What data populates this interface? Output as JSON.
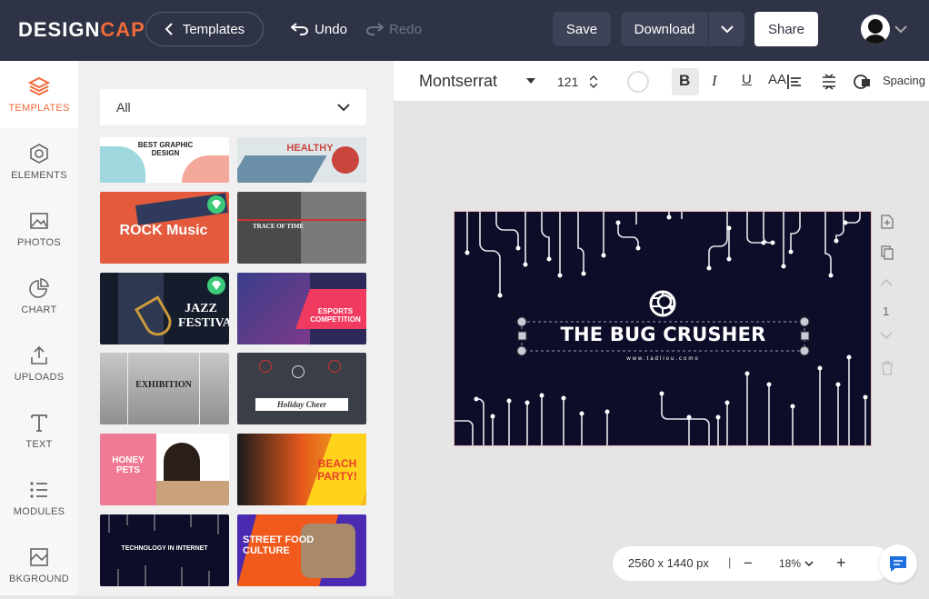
{
  "header": {
    "logo_main": "DESIGN",
    "logo_accent": "CAP",
    "templates_label": "Templates",
    "undo_label": "Undo",
    "redo_label": "Redo",
    "save_label": "Save",
    "download_label": "Download",
    "share_label": "Share"
  },
  "sidebar": {
    "items": [
      {
        "label": "TEMPLATES",
        "icon": "layers-icon"
      },
      {
        "label": "ELEMENTS",
        "icon": "shapes-icon"
      },
      {
        "label": "PHOTOS",
        "icon": "image-icon"
      },
      {
        "label": "CHART",
        "icon": "pie-chart-icon"
      },
      {
        "label": "UPLOADS",
        "icon": "upload-icon"
      },
      {
        "label": "TEXT",
        "icon": "text-icon"
      },
      {
        "label": "MODULES",
        "icon": "list-icon"
      },
      {
        "label": "BKGROUND",
        "icon": "background-icon"
      }
    ]
  },
  "panel": {
    "filter_value": "All",
    "thumbs": [
      {
        "title": "BEST GRAPHIC DESIGN"
      },
      {
        "title": "HEALTHY"
      },
      {
        "title": "ROCK Music"
      },
      {
        "title": "TRACE OF TIME"
      },
      {
        "title": "JAZZ FESTIVAL"
      },
      {
        "title": "ESPORTS COMPETITION"
      },
      {
        "title": "EXHIBITION"
      },
      {
        "title": "Holiday Cheer"
      },
      {
        "title": "HONEY PETS"
      },
      {
        "title": "BEACH PARTY!"
      },
      {
        "title": "TECHNOLOGY IN INTERNET"
      },
      {
        "title": "STREET FOOD CULTURE"
      }
    ]
  },
  "toolbar": {
    "font": "Montserrat",
    "size": "121",
    "bold": "B",
    "italic": "I",
    "underline": "U",
    "case": "AA",
    "spacing": "Spacing"
  },
  "canvas": {
    "headline": "THE BUG CRUSHER",
    "subline": "www.tadliou.como",
    "page_number": "1"
  },
  "zoom": {
    "dimensions": "2560 x 1440 px",
    "level": "18%",
    "minus": "−",
    "plus": "+"
  },
  "colors": {
    "header_bg": "#2f3346",
    "accent": "#f06a3b",
    "canvas_bg": "#0d0d29"
  }
}
